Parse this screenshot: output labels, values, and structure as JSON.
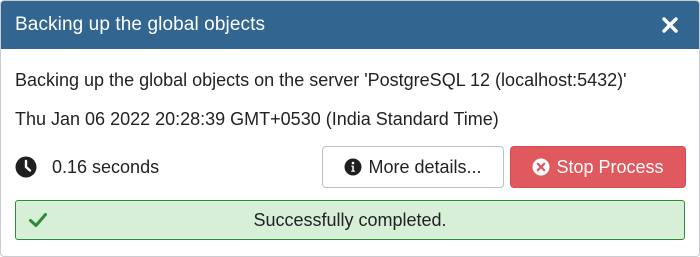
{
  "dialog": {
    "title": "Backing up the global objects",
    "close_icon": "close-icon"
  },
  "details": {
    "description": "Backing up the global objects on the server 'PostgreSQL 12 (localhost:5432)'",
    "timestamp": "Thu Jan 06 2022 20:28:39 GMT+0530 (India Standard Time)"
  },
  "status": {
    "elapsed_icon": "clock-icon",
    "elapsed": "0.16 seconds",
    "more_details_icon": "info-circle-icon",
    "more_details_label": "More details...",
    "stop_icon": "times-circle-icon",
    "stop_label": "Stop Process"
  },
  "result": {
    "icon": "check-icon",
    "message": "Successfully completed."
  },
  "colors": {
    "titlebar": "#326690",
    "stop_button": "#e0595e",
    "success_bg": "#d7efd7",
    "success_border": "#2e8b3a",
    "success_icon": "#2e8b3a"
  }
}
